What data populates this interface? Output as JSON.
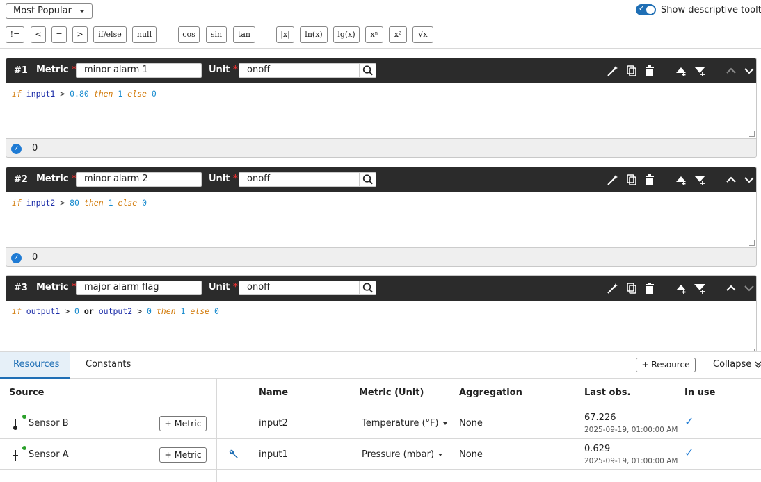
{
  "toolbar": {
    "sort_label": "Most Popular",
    "tooltips_label": "Show descriptive tooltips",
    "ops": [
      "!=",
      "<",
      "=",
      ">",
      "if/else",
      "null",
      "cos",
      "sin",
      "tan",
      "|x|",
      "ln(x)",
      "lg(x)",
      "xⁿ",
      "x²",
      "√x"
    ]
  },
  "labels": {
    "metric": "Metric",
    "unit": "Unit",
    "req": "*"
  },
  "blocks": [
    {
      "num": "#1",
      "metric": "minor alarm 1",
      "unit": "onoff",
      "result": "0",
      "code": [
        [
          "kw",
          "if"
        ],
        [
          "sp",
          " "
        ],
        [
          "var",
          "input1"
        ],
        [
          "sp",
          " > "
        ],
        [
          "num2",
          "0.80"
        ],
        [
          "sp",
          " "
        ],
        [
          "kw",
          "then"
        ],
        [
          "sp",
          " "
        ],
        [
          "num2",
          "1"
        ],
        [
          "sp",
          " "
        ],
        [
          "kw",
          "else"
        ],
        [
          "sp",
          " "
        ],
        [
          "num2",
          "0"
        ]
      ]
    },
    {
      "num": "#2",
      "metric": "minor alarm 2",
      "unit": "onoff",
      "result": "0",
      "code": [
        [
          "kw",
          "if"
        ],
        [
          "sp",
          " "
        ],
        [
          "var",
          "input2"
        ],
        [
          "sp",
          " > "
        ],
        [
          "num2",
          "80"
        ],
        [
          "sp",
          " "
        ],
        [
          "kw",
          "then"
        ],
        [
          "sp",
          " "
        ],
        [
          "num2",
          "1"
        ],
        [
          "sp",
          " "
        ],
        [
          "kw",
          "else"
        ],
        [
          "sp",
          " "
        ],
        [
          "num2",
          "0"
        ]
      ]
    },
    {
      "num": "#3",
      "metric": "major alarm flag",
      "unit": "onoff",
      "code": [
        [
          "kw",
          "if"
        ],
        [
          "sp",
          " "
        ],
        [
          "var",
          "output1"
        ],
        [
          "sp",
          " > "
        ],
        [
          "num2",
          "0"
        ],
        [
          "sp",
          " "
        ],
        [
          "bool",
          "or"
        ],
        [
          "sp",
          " "
        ],
        [
          "var",
          "output2"
        ],
        [
          "sp",
          " > "
        ],
        [
          "num2",
          "0"
        ],
        [
          "sp",
          " "
        ],
        [
          "kw",
          "then"
        ],
        [
          "sp",
          " "
        ],
        [
          "num2",
          "1"
        ],
        [
          "sp",
          " "
        ],
        [
          "kw",
          "else"
        ],
        [
          "sp",
          " "
        ],
        [
          "num2",
          "0"
        ]
      ]
    }
  ],
  "panel": {
    "tabs": [
      "Resources",
      "Constants"
    ],
    "add_resource": "+ Resource",
    "collapse": "Collapse",
    "headers": {
      "source": "Source",
      "name": "Name",
      "metric": "Metric (Unit)",
      "aggregation": "Aggregation",
      "last_obs": "Last obs.",
      "in_use": "In use"
    },
    "rows": [
      {
        "source": "Sensor B",
        "metric_btn": "+ Metric",
        "name": "input2",
        "metric": "Temperature (°F)",
        "aggregation": "None",
        "value": "67.226",
        "time": "2025-09-19, 01:00:00 AM"
      },
      {
        "source": "Sensor A",
        "metric_btn": "+ Metric",
        "name": "input1",
        "metric": "Pressure (mbar)",
        "aggregation": "None",
        "value": "0.629",
        "time": "2025-09-19, 01:00:00 AM"
      }
    ]
  },
  "colors": {
    "accent": "#1f6fb5",
    "keyword": "#d27b0b",
    "variable": "#1b2ca8",
    "number": "#1a8ccf",
    "online": "#2aa02a"
  }
}
